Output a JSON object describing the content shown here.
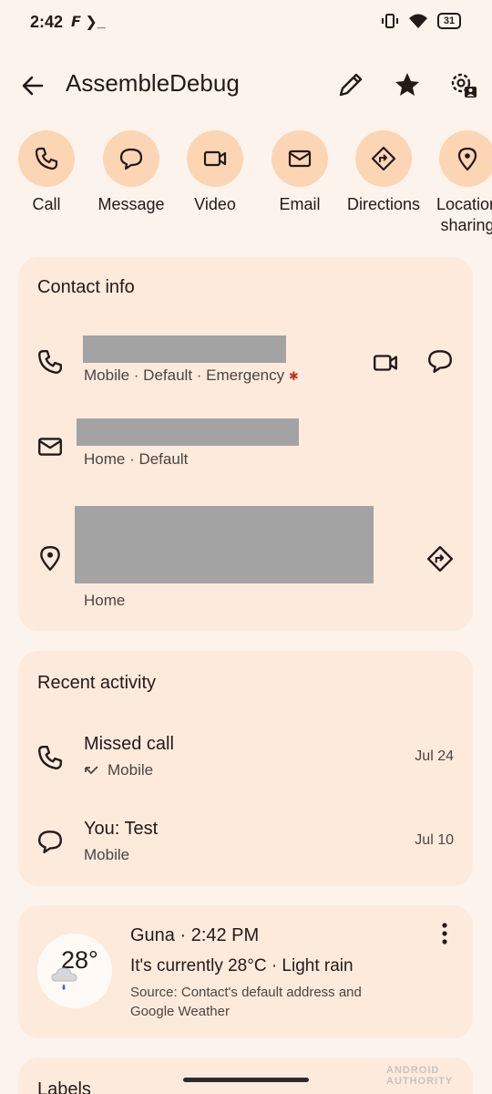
{
  "status": {
    "time": "2:42",
    "left_icons": "𝙁 ❯_",
    "battery": "31"
  },
  "app_bar": {
    "title": "AssembleDebug"
  },
  "actions": [
    {
      "label": "Call",
      "icon": "phone-icon"
    },
    {
      "label": "Message",
      "icon": "message-icon"
    },
    {
      "label": "Video",
      "icon": "video-icon"
    },
    {
      "label": "Email",
      "icon": "email-icon"
    },
    {
      "label": "Directions",
      "icon": "directions-icon"
    },
    {
      "label": "Location sharing",
      "icon": "location-pin-icon"
    }
  ],
  "contact_info": {
    "title": "Contact info",
    "phone_sub": "Mobile · Default · Emergency",
    "emergency_mark": "✱",
    "email_sub": "Home · Default",
    "address_sub": "Home"
  },
  "recent_activity": {
    "title": "Recent activity",
    "items": [
      {
        "primary": "Missed call",
        "secondary": "Mobile",
        "date": "Jul 24"
      },
      {
        "primary": "You: Test",
        "secondary": "Mobile",
        "date": "Jul 10"
      }
    ]
  },
  "weather": {
    "temp": "28°",
    "heading": "Guna · 2:42 PM",
    "summary": "It's currently 28°C · Light rain",
    "source": "Source: Contact's default address and Google Weather"
  },
  "labels": {
    "title": "Labels"
  },
  "watermark": "ANDROID AUTHORITY",
  "colors": {
    "background": "#fdf3ed",
    "card": "#fcebdd",
    "action_circle": "#fcd6b4",
    "redacted": "#a3a3a3",
    "emergency": "#c2321d"
  }
}
